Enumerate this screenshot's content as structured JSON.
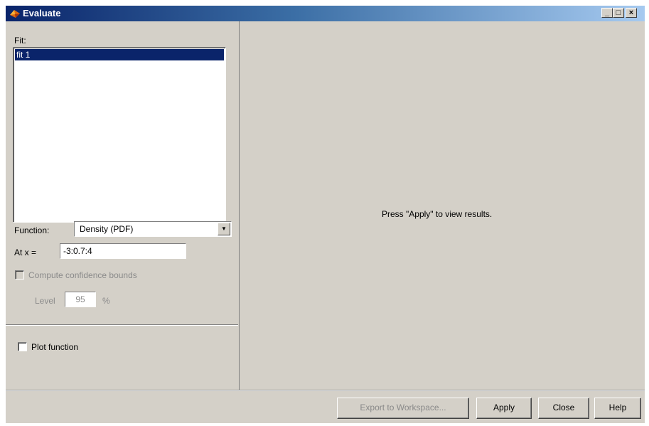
{
  "window": {
    "title": "Evaluate",
    "controls": {
      "minimize": "_",
      "maximize": "□",
      "close": "×"
    }
  },
  "left": {
    "fit_label": "Fit:",
    "fits": [
      "fit 1"
    ],
    "function_label": "Function:",
    "function_value": "Density (PDF)",
    "atx_label": "At x =",
    "atx_value": "-3:0.7:4",
    "confidence_label": "Compute confidence bounds",
    "level_label": "Level",
    "level_value": "95",
    "level_unit": "%",
    "plot_label": "Plot function"
  },
  "right": {
    "message": "Press \"Apply\" to view results."
  },
  "buttons": {
    "export": "Export to Workspace...",
    "apply": "Apply",
    "close": "Close",
    "help": "Help"
  },
  "icons": {
    "app": "matlab-logo-icon",
    "dropdown": "triangle-down-icon"
  },
  "colors": {
    "titlebar_start": "#0a246a",
    "titlebar_end": "#a6caf0",
    "window_bg": "#d4d0c8",
    "selection": "#0a246a"
  }
}
